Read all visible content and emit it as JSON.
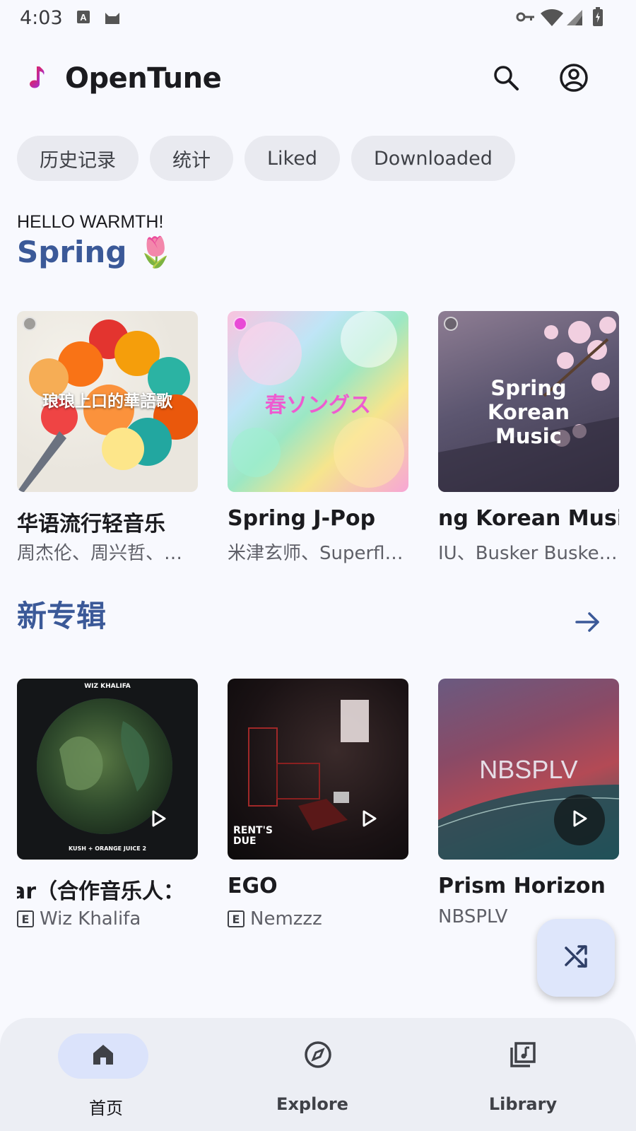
{
  "status_bar": {
    "time": "4:03"
  },
  "app": {
    "title": "OpenTune",
    "accent": "#3b5998"
  },
  "icons": {
    "logo": "music-note-icon",
    "search": "search-icon",
    "account": "account-circle-icon"
  },
  "chips": [
    "历史记录",
    "统计",
    "Liked",
    "Downloaded"
  ],
  "sections": {
    "spring": {
      "kicker": "HELLO WARMTH!",
      "title": "Spring 🌷",
      "cards": [
        {
          "cover_text": "琅琅上口的華語歌",
          "title": "华语流行轻音乐",
          "subtitle": "周杰伦、周兴哲、…"
        },
        {
          "cover_text": "春ソングス",
          "title": "Spring J-Pop",
          "subtitle": "米津玄师、Superfl…"
        },
        {
          "cover_text": "Spring Korean Music",
          "title": "ng Korean Music",
          "subtitle": "IU、Busker Busker…"
        }
      ]
    },
    "new_albums": {
      "title": "新专辑",
      "cards": [
        {
          "cover_text": "WIZ KHALIFA",
          "cover_subtext": "KUSH + ORANGE JUICE 2",
          "title": "ar（合作音乐人：",
          "artist": "Wiz Khalifa",
          "explicit": "E"
        },
        {
          "cover_text": "RENT'S DUE",
          "title": "EGO",
          "artist": "Nemzzz",
          "explicit": "E"
        },
        {
          "cover_text": "NBSPLV",
          "title": "Prism Horizon",
          "artist": "NBSPLV"
        }
      ]
    }
  },
  "fab": {
    "icon": "shuffle-icon"
  },
  "nav": [
    {
      "label": "首页",
      "icon": "home-icon",
      "active": true
    },
    {
      "label": "Explore",
      "icon": "explore-icon",
      "active": false
    },
    {
      "label": "Library",
      "icon": "library-music-icon",
      "active": false
    }
  ]
}
